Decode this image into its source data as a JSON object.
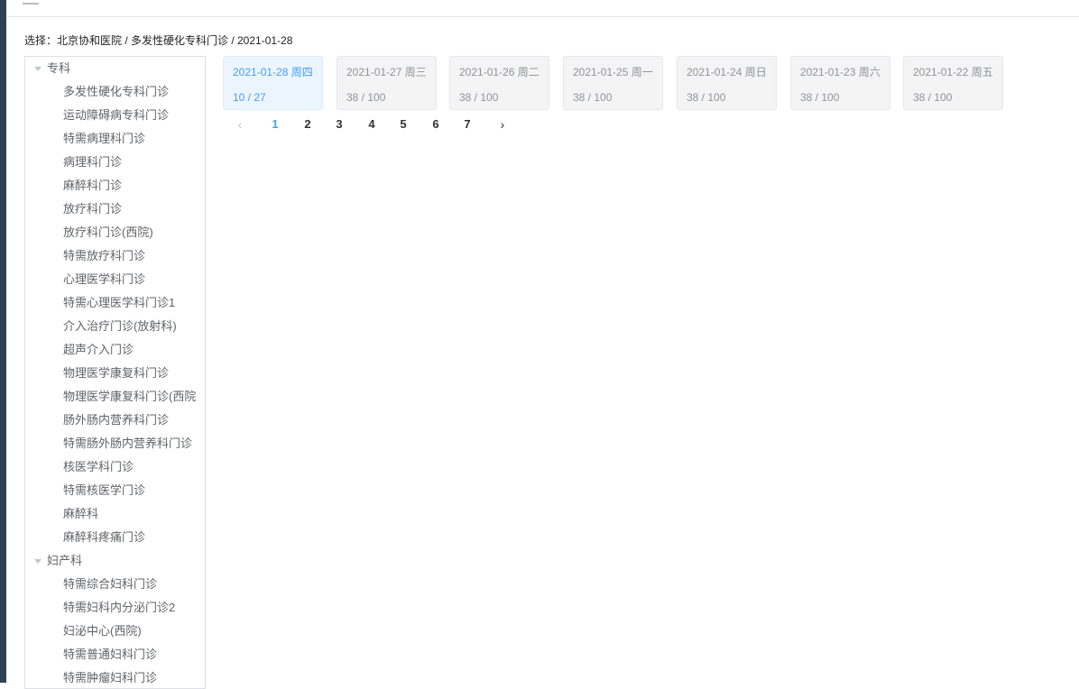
{
  "breadcrumb": {
    "text": "选择：北京协和医院 / 多发性硬化专科门诊 / 2021-01-28"
  },
  "tree": {
    "groups": [
      {
        "label": "专科",
        "items": [
          "多发性硬化专科门诊",
          "运动障碍病专科门诊",
          "特需病理科门诊",
          "病理科门诊",
          "麻醉科门诊",
          "放疗科门诊",
          "放疗科门诊(西院)",
          "特需放疗科门诊",
          "心理医学科门诊",
          "特需心理医学科门诊1",
          "介入治疗门诊(放射科)",
          "超声介入门诊",
          "物理医学康复科门诊",
          "物理医学康复科门诊(西院",
          "肠外肠内营养科门诊",
          "特需肠外肠内营养科门诊",
          "核医学科门诊",
          "特需核医学门诊",
          "麻醉科",
          "麻醉科疼痛门诊"
        ]
      },
      {
        "label": "妇产科",
        "items": [
          "特需综合妇科门诊",
          "特需妇科内分泌门诊2",
          "妇泌中心(西院)",
          "特需普通妇科门诊",
          "特需肿瘤妇科门诊"
        ]
      }
    ]
  },
  "date_cards": [
    {
      "date": "2021-01-28 周四",
      "quota": "10 / 27",
      "active": true
    },
    {
      "date": "2021-01-27 周三",
      "quota": "38 / 100",
      "active": false
    },
    {
      "date": "2021-01-26 周二",
      "quota": "38 / 100",
      "active": false
    },
    {
      "date": "2021-01-25 周一",
      "quota": "38 / 100",
      "active": false
    },
    {
      "date": "2021-01-24 周日",
      "quota": "38 / 100",
      "active": false
    },
    {
      "date": "2021-01-23 周六",
      "quota": "38 / 100",
      "active": false
    },
    {
      "date": "2021-01-22 周五",
      "quota": "38 / 100",
      "active": false
    }
  ],
  "pagination": {
    "pages": [
      "1",
      "2",
      "3",
      "4",
      "5",
      "6",
      "7"
    ],
    "current": "1",
    "prev_icon": "chevron-left-icon",
    "next_icon": "chevron-right-icon"
  },
  "colors": {
    "accent": "#409eff",
    "sidebar": "#304156"
  }
}
